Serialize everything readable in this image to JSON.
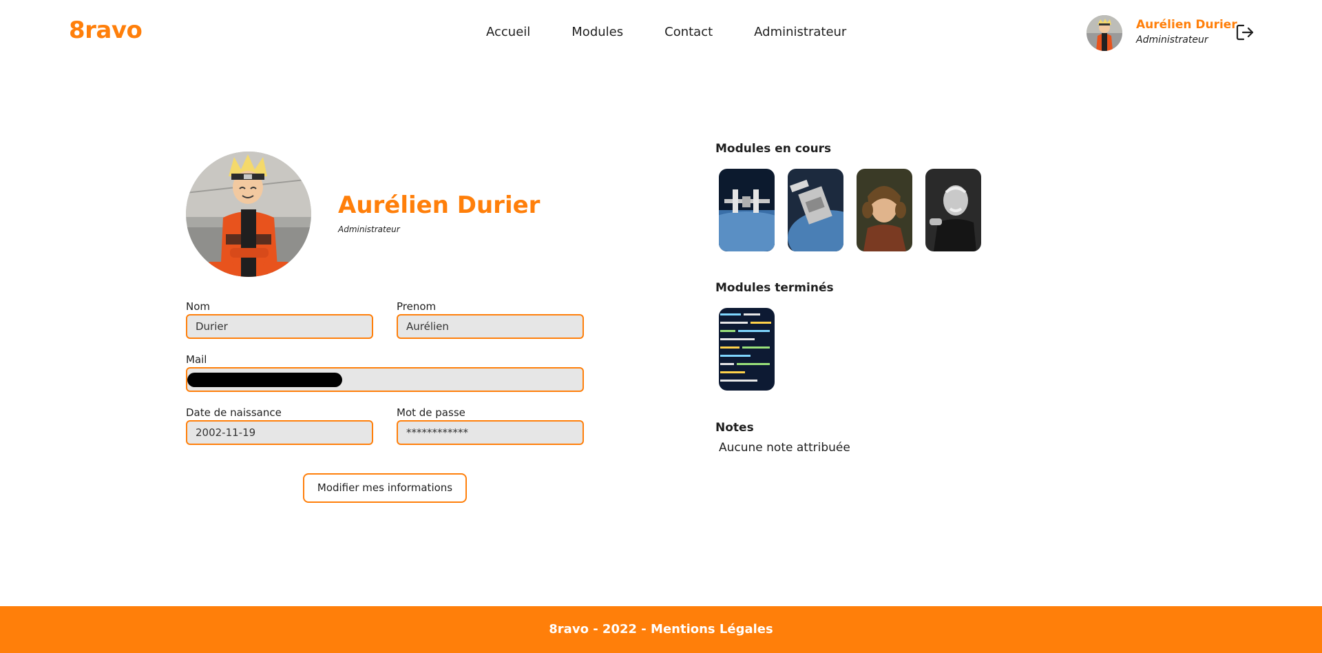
{
  "header": {
    "logo": "8ravo",
    "nav": [
      "Accueil",
      "Modules",
      "Contact",
      "Administrateur"
    ],
    "user": {
      "name": "Aurélien Durier",
      "role": "Administrateur"
    },
    "logout_icon": "logout-icon"
  },
  "profile": {
    "name": "Aurélien Durier",
    "role": "Administrateur",
    "form": {
      "nom_label": "Nom",
      "nom_value": "Durier",
      "prenom_label": "Prenom",
      "prenom_value": "Aurélien",
      "mail_label": "Mail",
      "naissance_label": "Date de naissance",
      "naissance_value": "2002-11-19",
      "password_label": "Mot de passe",
      "password_value": "************"
    },
    "modify_button": "Modifier mes informations"
  },
  "modules": {
    "in_progress_title": "Modules en cours",
    "completed_title": "Modules terminés",
    "notes_title": "Notes",
    "notes_text": "Aucune note attribuée"
  },
  "footer": {
    "text": "8ravo - 2022 - Mentions Légales"
  },
  "colors": {
    "accent": "#ff7f0a",
    "field_bg": "#e6e6e6",
    "text": "#1e1e1e"
  }
}
